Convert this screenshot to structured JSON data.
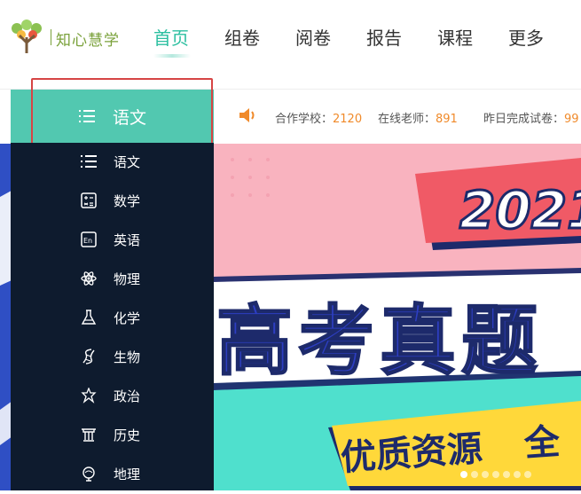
{
  "header": {
    "logo_text": "知心慧学",
    "nav": [
      {
        "label": "首页",
        "active": true
      },
      {
        "label": "组卷",
        "active": false
      },
      {
        "label": "阅卷",
        "active": false
      },
      {
        "label": "报告",
        "active": false
      },
      {
        "label": "课程",
        "active": false
      },
      {
        "label": "更多",
        "active": false
      }
    ]
  },
  "subject_selector": {
    "label": "语文",
    "icon": "list-icon"
  },
  "stats": [
    {
      "label": "合作学校：",
      "value": "2120"
    },
    {
      "label": "在线老师：",
      "value": "891"
    },
    {
      "label": "昨日完成试卷：",
      "value": "99"
    }
  ],
  "menu": {
    "items": [
      {
        "label": "语文",
        "icon": "list-icon"
      },
      {
        "label": "数学",
        "icon": "calculator-icon"
      },
      {
        "label": "英语",
        "icon": "en-icon"
      },
      {
        "label": "物理",
        "icon": "atom-icon"
      },
      {
        "label": "化学",
        "icon": "flask-icon"
      },
      {
        "label": "生物",
        "icon": "dna-icon"
      },
      {
        "label": "政治",
        "icon": "politics-icon"
      },
      {
        "label": "历史",
        "icon": "temple-icon"
      },
      {
        "label": "地理",
        "icon": "globe-icon"
      }
    ]
  },
  "banner": {
    "year": "2021",
    "headline": "高考真题",
    "subline": "优质资源",
    "subline_tail": "全",
    "dots": 7,
    "active_dot": 0
  },
  "colors": {
    "accent": "#2bbfa0",
    "subject_bar": "#52c8b0",
    "menu_bg": "#0e1b2e",
    "stat_number": "#f08a2a",
    "highlight": "#d64545",
    "banner_pink": "#f9b3bf",
    "banner_teal": "#4fe0cd",
    "banner_blue": "#2f4fc4"
  }
}
